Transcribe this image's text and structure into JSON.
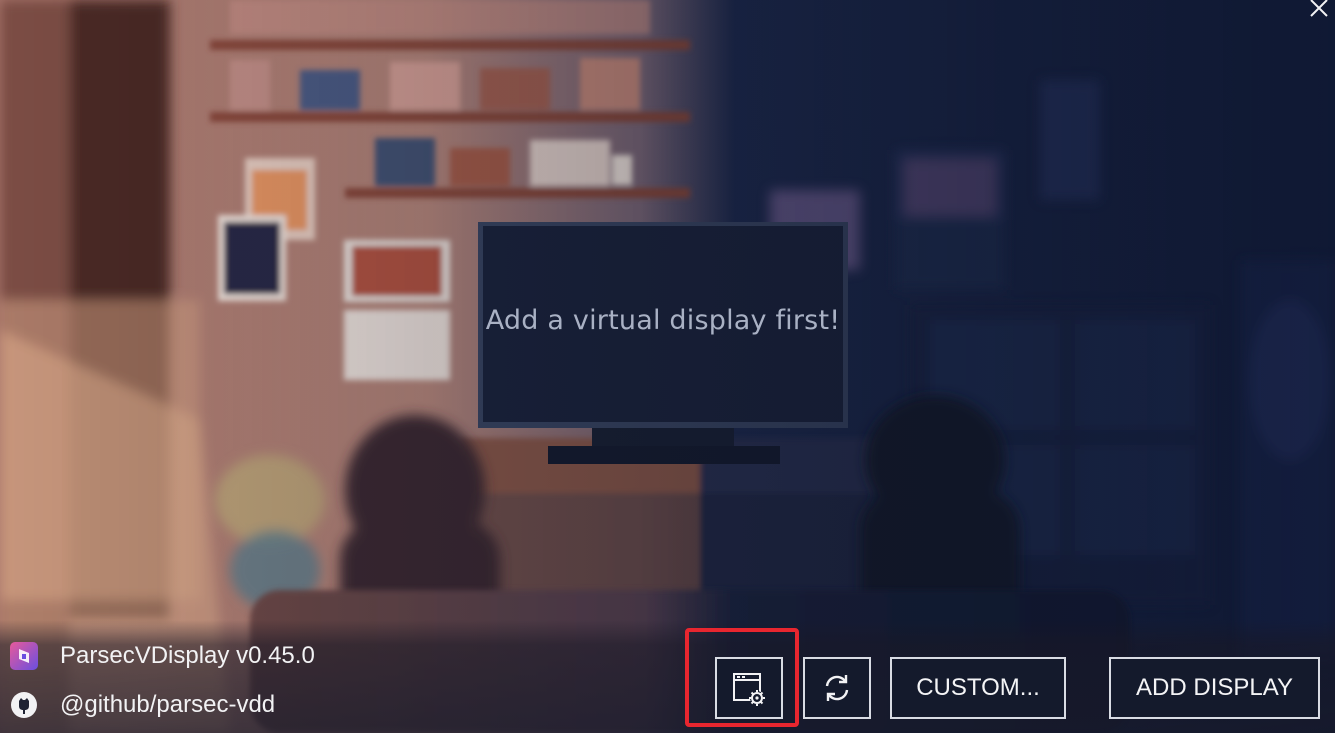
{
  "window": {
    "close_icon": "close-icon"
  },
  "main": {
    "empty_message": "Add a virtual display first!"
  },
  "footer": {
    "app_name": "ParsecVDisplay v0.45.0",
    "github": "@github/parsec-vdd",
    "app_icon": "parsec-logo-icon",
    "github_icon": "github-icon"
  },
  "toolbar": {
    "settings_icon": "display-settings-icon",
    "refresh_icon": "refresh-icon",
    "custom_label": "CUSTOM...",
    "add_display_label": "ADD DISPLAY"
  },
  "colors": {
    "highlight": "#e8262f",
    "button_border": "#d9dce4",
    "button_bg": "#141a2c",
    "text": "#f2f2f4",
    "message_text": "#a9b1c4"
  }
}
